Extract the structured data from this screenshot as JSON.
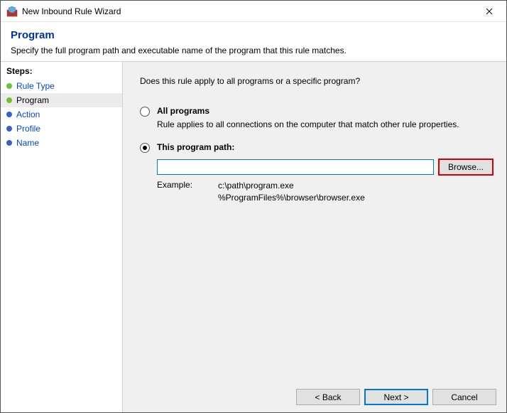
{
  "window": {
    "title": "New Inbound Rule Wizard"
  },
  "header": {
    "title": "Program",
    "subtitle": "Specify the full program path and executable name of the program that this rule matches."
  },
  "sidebar": {
    "stepsLabel": "Steps:",
    "steps": [
      {
        "label": "Rule Type",
        "state": "done"
      },
      {
        "label": "Program",
        "state": "current"
      },
      {
        "label": "Action",
        "state": "pending"
      },
      {
        "label": "Profile",
        "state": "pending"
      },
      {
        "label": "Name",
        "state": "pending"
      }
    ]
  },
  "content": {
    "question": "Does this rule apply to all programs or a specific program?",
    "option1": {
      "label": "All programs",
      "desc": "Rule applies to all connections on the computer that match other rule properties."
    },
    "option2": {
      "label": "This program path:",
      "pathValue": "",
      "browseLabel": "Browse...",
      "exampleLabel": "Example:",
      "exampleText": "c:\\path\\program.exe\n%ProgramFiles%\\browser\\browser.exe"
    }
  },
  "footer": {
    "back": "< Back",
    "next": "Next >",
    "cancel": "Cancel"
  }
}
